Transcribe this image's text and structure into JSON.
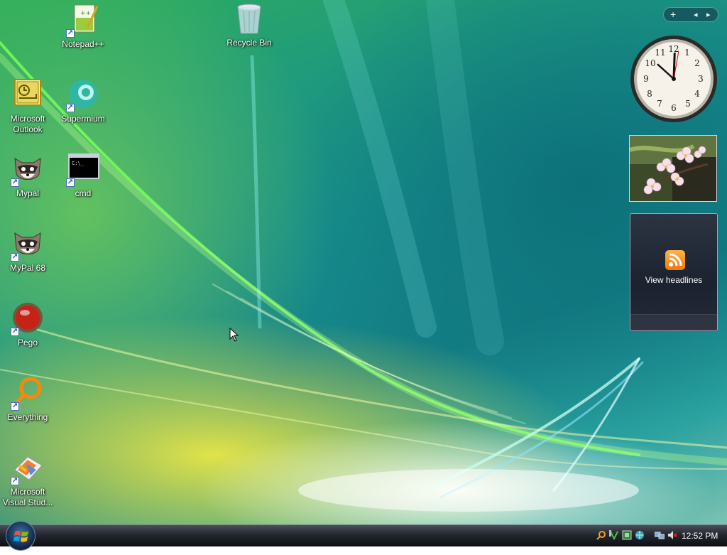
{
  "desktop": {
    "icons": [
      {
        "label": "Notepad++"
      },
      {
        "label": "Recycle Bin"
      },
      {
        "label": "Microsoft Outlook"
      },
      {
        "label": "Supermium"
      },
      {
        "label": "Mypal"
      },
      {
        "label": "cmd"
      },
      {
        "label": "MyPal 68"
      },
      {
        "label": "Pego"
      },
      {
        "label": "Everything"
      },
      {
        "label": "Microsoft Visual Stud..."
      }
    ]
  },
  "sidebar": {
    "controls": {
      "add": "+",
      "prev": "◂",
      "next": "▸"
    },
    "clock": {
      "time": "12:52"
    },
    "feed": {
      "text": "View headlines"
    }
  },
  "taskbar": {
    "clock": "12:52 PM",
    "tray_icons": [
      "search-icon",
      "antivirus-icon",
      "media-icon",
      "network-share-icon",
      "network-icon",
      "volume-muted-icon"
    ]
  },
  "colors": {
    "taskbar": "#1a1d23",
    "feed_accent": "#f08a1c"
  }
}
